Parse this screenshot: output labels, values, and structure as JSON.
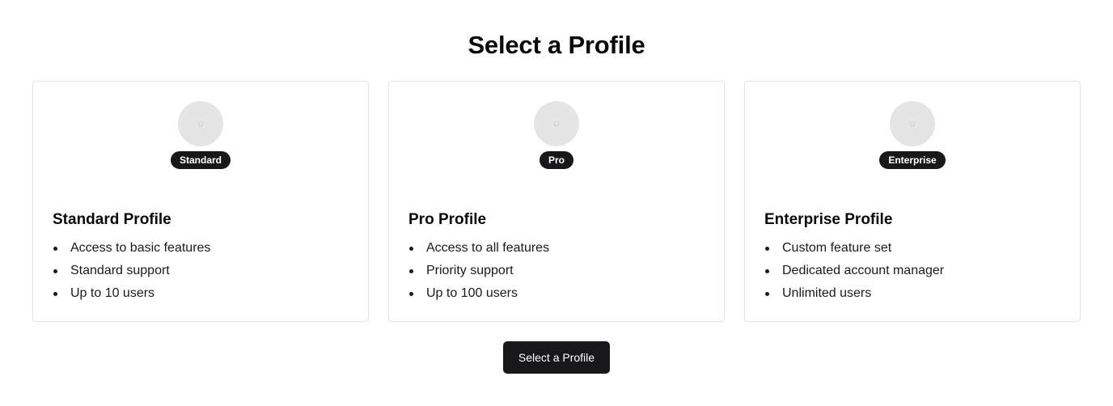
{
  "page": {
    "title": "Select a Profile"
  },
  "profiles": [
    {
      "badge": "Standard",
      "avatar_icon": "image-placeholder-icon",
      "title": "Standard Profile",
      "features": [
        "Access to basic features",
        "Standard support",
        "Up to 10 users"
      ]
    },
    {
      "badge": "Pro",
      "avatar_icon": "image-placeholder-icon",
      "title": "Pro Profile",
      "features": [
        "Access to all features",
        "Priority support",
        "Up to 100 users"
      ]
    },
    {
      "badge": "Enterprise",
      "avatar_icon": "image-placeholder-icon",
      "title": "Enterprise Profile",
      "features": [
        "Custom feature set",
        "Dedicated account manager",
        "Unlimited users"
      ]
    }
  ],
  "actions": {
    "select_label": "Select a Profile"
  },
  "colors": {
    "primary": "#18181b",
    "card_border": "#e4e4e7",
    "avatar_bg": "#e5e5e5",
    "background": "#ffffff"
  }
}
